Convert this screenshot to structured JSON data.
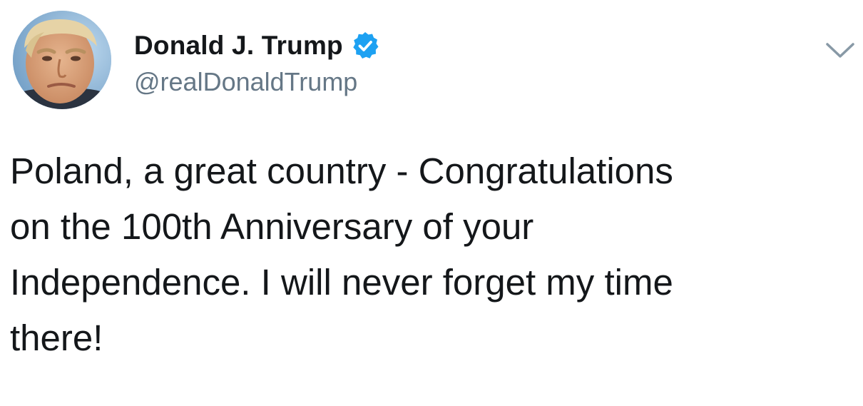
{
  "tweet": {
    "author": {
      "display_name": "Donald J. Trump",
      "handle": "@realDonaldTrump",
      "verified_icon": "verified-badge-icon",
      "avatar_icon": "profile-photo"
    },
    "menu_icon": "chevron-down-icon",
    "text": "Poland, a great country - Congratulations\non the 100th Anniversary of your\nIndependence. I will never forget my time\nthere!"
  },
  "colors": {
    "verified_blue": "#1da1f2",
    "handle_gray": "#657786",
    "text_dark": "#14171a",
    "chevron_gray": "#8899a6"
  }
}
